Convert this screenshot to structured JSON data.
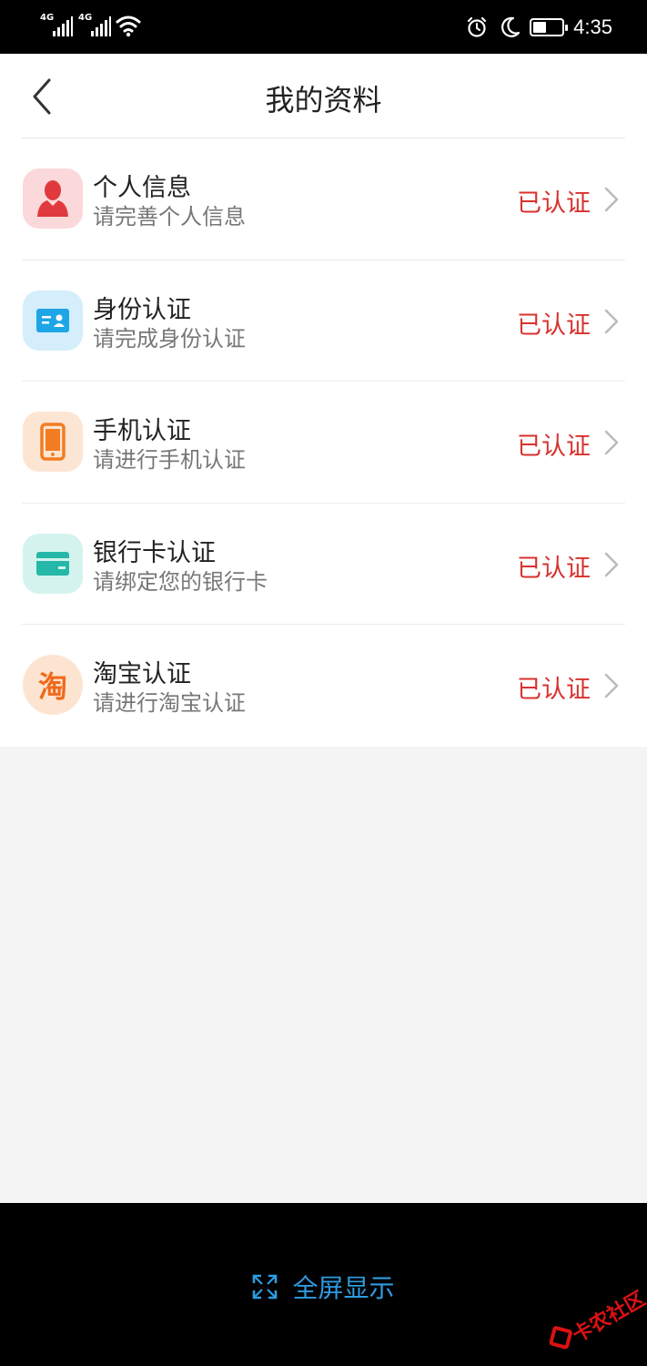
{
  "statusbar": {
    "sim1": "4G",
    "sim2": "4G",
    "time": "4:35",
    "battery_level": 0.45,
    "icons": [
      "signal-icon",
      "signal-icon",
      "wifi-icon",
      "alarm-icon",
      "moon-icon",
      "battery-icon"
    ]
  },
  "header": {
    "title": "我的资料",
    "back_icon": "chevron-left-icon"
  },
  "items": [
    {
      "title": "个人信息",
      "subtitle": "请完善个人信息",
      "status": "已认证",
      "icon": "person-icon",
      "icon_bg": "#fbd8da",
      "icon_color": "#e03a3e"
    },
    {
      "title": "身份认证",
      "subtitle": "请完成身份认证",
      "status": "已认证",
      "icon": "id-card-icon",
      "icon_bg": "#d4eefb",
      "icon_color": "#1ea5e6"
    },
    {
      "title": "手机认证",
      "subtitle": "请进行手机认证",
      "status": "已认证",
      "icon": "phone-icon",
      "icon_bg": "#fde5d3",
      "icon_color": "#f27c22"
    },
    {
      "title": "银行卡认证",
      "subtitle": "请绑定您的银行卡",
      "status": "已认证",
      "icon": "bank-card-icon",
      "icon_bg": "#d4f3ef",
      "icon_color": "#25b8a8"
    },
    {
      "title": "淘宝认证",
      "subtitle": "请进行淘宝认证",
      "status": "已认证",
      "icon": "taobao-icon",
      "icon_glyph": "淘",
      "icon_bg": "#fde4d0",
      "icon_color": "#f06a1c"
    }
  ],
  "bottom": {
    "fullscreen_label": "全屏显示",
    "fullscreen_icon": "expand-icon",
    "watermark": "卡农社区"
  },
  "colors": {
    "status_red": "#d8322e",
    "link_blue": "#2f9be0",
    "page_bg": "#f4f4f4"
  }
}
